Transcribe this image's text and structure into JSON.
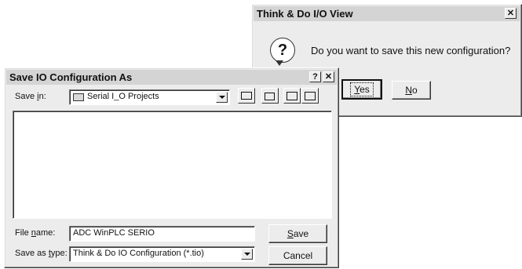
{
  "confirm_dialog": {
    "title": "Think & Do I/O View",
    "close_glyph": "✕",
    "question_glyph": "?",
    "message": "Do you want to save this new configuration?",
    "yes_mnemonic": "Y",
    "yes_rest": "es",
    "no_mnemonic": "N",
    "no_rest": "o"
  },
  "save_dialog": {
    "title": "Save IO Configuration As",
    "help_glyph": "?",
    "close_glyph": "✕",
    "save_in_pre": "Save ",
    "save_in_mnemonic": "i",
    "save_in_post": "n:",
    "save_in_value": "Serial I_O Projects",
    "file_name_pre": "File ",
    "file_name_mnemonic": "n",
    "file_name_post": "ame:",
    "file_name_value": "ADC WinPLC SERIO",
    "save_as_type_pre": "Save as ",
    "save_as_type_mnemonic": "t",
    "save_as_type_post": "ype:",
    "save_as_type_value": "Think & Do IO Configuration (*.tio)",
    "save_button_mnemonic": "S",
    "save_button_rest": "ave",
    "cancel_label": "Cancel"
  },
  "colors": {
    "dialog_face": "#ececec",
    "titlebar": "#d4d4d4",
    "field": "#ffffff"
  }
}
